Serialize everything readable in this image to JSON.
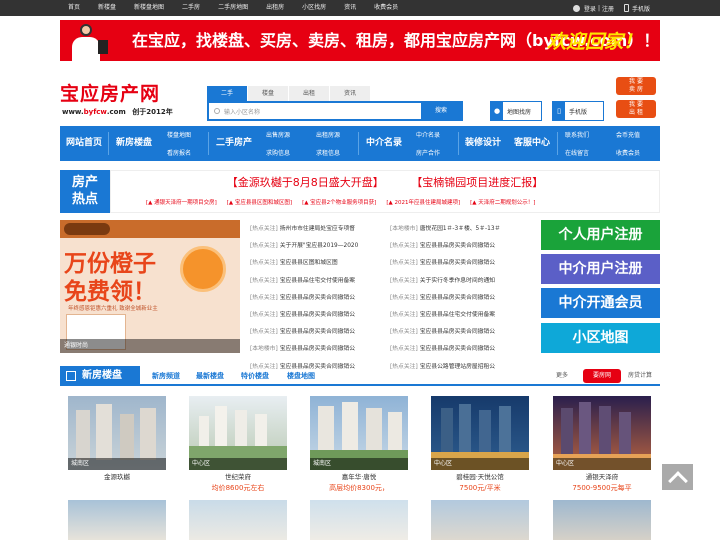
{
  "topbar": {
    "links": [
      "首页",
      "新楼盘",
      "新楼盘地图",
      "二手房",
      "二手房地图",
      "出租房",
      "小区找房",
      "资讯",
      "收费会员"
    ],
    "login": "登录",
    "sep": "|",
    "register": "注册",
    "mobile": "手机版"
  },
  "banner": {
    "text": "在宝应，找楼盘、买房、卖房、租房，都用宝应房产网（byfcw.com）！",
    "welcome": "欢迎回家！"
  },
  "logo": {
    "name": "宝应房产网",
    "url_prefix": "www.",
    "url_brand": "byfcw",
    "url_suffix": ".com",
    "founded": "创于2012年"
  },
  "search": {
    "tabs": [
      "二手",
      "楼盘",
      "出租",
      "资讯"
    ],
    "placeholder": "输入小区名称",
    "button": "搜索"
  },
  "quick": {
    "map": "地图找房",
    "mobile": "手机版",
    "sell": "我 要\n卖 房",
    "rent": "我 要\n出 租"
  },
  "nav": {
    "home": "网站首页",
    "newhouse": "新房楼盘",
    "newhouse_sub": [
      "楼盘地图",
      "看房报名"
    ],
    "second": "二手房产",
    "second_sub": [
      "出售房源",
      "求购信息"
    ],
    "rent_sub": [
      "出租房源",
      "求租信息"
    ],
    "agent": "中介名录",
    "agent_sub": [
      "中介名录",
      "房产合作"
    ],
    "decor": "装修设计",
    "service": "客服中心",
    "service_sub": [
      "联系我们",
      "在线留言"
    ],
    "member_sub": [
      "会币充值",
      "收费会员"
    ]
  },
  "hot": {
    "label1": "房产",
    "label2": "热点",
    "headlines": [
      "【金源玖樾于8月8日盛大开盘】",
      "【宝楠锦园项目进度汇报】"
    ],
    "sub": [
      "[▲ 通银天泽府一期项目交房]",
      "[▲ 宝应县县区图和城区图]",
      "[▲ 宝应县2个物业服务项目获]",
      "[▲ 2021年应县住建局城建项]",
      "[▲ 天泽府二期规划公示！]"
    ]
  },
  "promo": {
    "line1": "万份橙子",
    "line2": "免费领！",
    "tagline": "年终感恩钜惠六重礼  致谢全城新业主",
    "caption": "通银时尚"
  },
  "news_left": [
    {
      "tag": "[热点关注]",
      "title": "扬州市市住建局处宝应专项督"
    },
    {
      "tag": "[热点关注]",
      "title": "关于开展\"宝应县2019—2020"
    },
    {
      "tag": "[热点关注]",
      "title": "宝应县县区图和城区图"
    },
    {
      "tag": "[热点关注]",
      "title": "宝应县县品住宅交付使用备案"
    },
    {
      "tag": "[热点关注]",
      "title": "宝应县县品房买卖合同撤销公"
    },
    {
      "tag": "[热点关注]",
      "title": "宝应县县品房买卖合同撤销公"
    },
    {
      "tag": "[热点关注]",
      "title": "宝应县县品房买卖合同撤销公"
    },
    {
      "tag": "[本地楼市]",
      "title": "宝应县县品房买卖合同撤销公"
    },
    {
      "tag": "[热点关注]",
      "title": "宝应县县品房买卖合同撤销公"
    }
  ],
  "news_right": [
    {
      "tag": "[本地楼市]",
      "title": "唐悦花园1＃-3＃楼、5＃-13＃"
    },
    {
      "tag": "[热点关注]",
      "title": "宝应县县品房买卖合同撤销公"
    },
    {
      "tag": "[热点关注]",
      "title": "宝应县县品房买卖合同撤销公"
    },
    {
      "tag": "[热点关注]",
      "title": "关于实行冬季作息时间的通知"
    },
    {
      "tag": "[热点关注]",
      "title": "宝应县县品房买卖合同撤销公"
    },
    {
      "tag": "[热点关注]",
      "title": "宝应县县品住宅交付使用备案"
    },
    {
      "tag": "[热点关注]",
      "title": "宝应县县品房买卖合同撤销公"
    },
    {
      "tag": "[热点关注]",
      "title": "宝应县县品房买卖合同撤销公"
    },
    {
      "tag": "[热点关注]",
      "title": "宝应县公路管理站房屋招租公"
    }
  ],
  "user_buttons": [
    {
      "label": "个人用户注册",
      "color": "#1aa33a"
    },
    {
      "label": "中介用户注册",
      "color": "#5b5fc7"
    },
    {
      "label": "中介开通会员",
      "color": "#1a78d4"
    },
    {
      "label": "小区地图",
      "color": "#0ea8d8"
    }
  ],
  "section": {
    "title": "新房楼盘",
    "tabs": [
      "新房频道",
      "最新楼盘",
      "特价楼盘",
      "楼盘地图"
    ],
    "more": "更多",
    "sell": "要房网",
    "calc": "房贷计算"
  },
  "listings": [
    {
      "district": "城南区",
      "name": "金源玖樾",
      "price": ""
    },
    {
      "district": "中心区",
      "name": "世纪荣府",
      "price": "均价8600元左右"
    },
    {
      "district": "城南区",
      "name": "嘉年华·唐悦",
      "price": "高层均价8300元，"
    },
    {
      "district": "中心区",
      "name": "碧桂园·天悦公馆",
      "price": "7500元/平米"
    },
    {
      "district": "中心区",
      "name": "通银天泽府",
      "price": "7500-9500元每平"
    }
  ],
  "colors": {
    "primary": "#1a78d4",
    "accent_red": "#e60012",
    "price_orange": "#e8451a"
  }
}
